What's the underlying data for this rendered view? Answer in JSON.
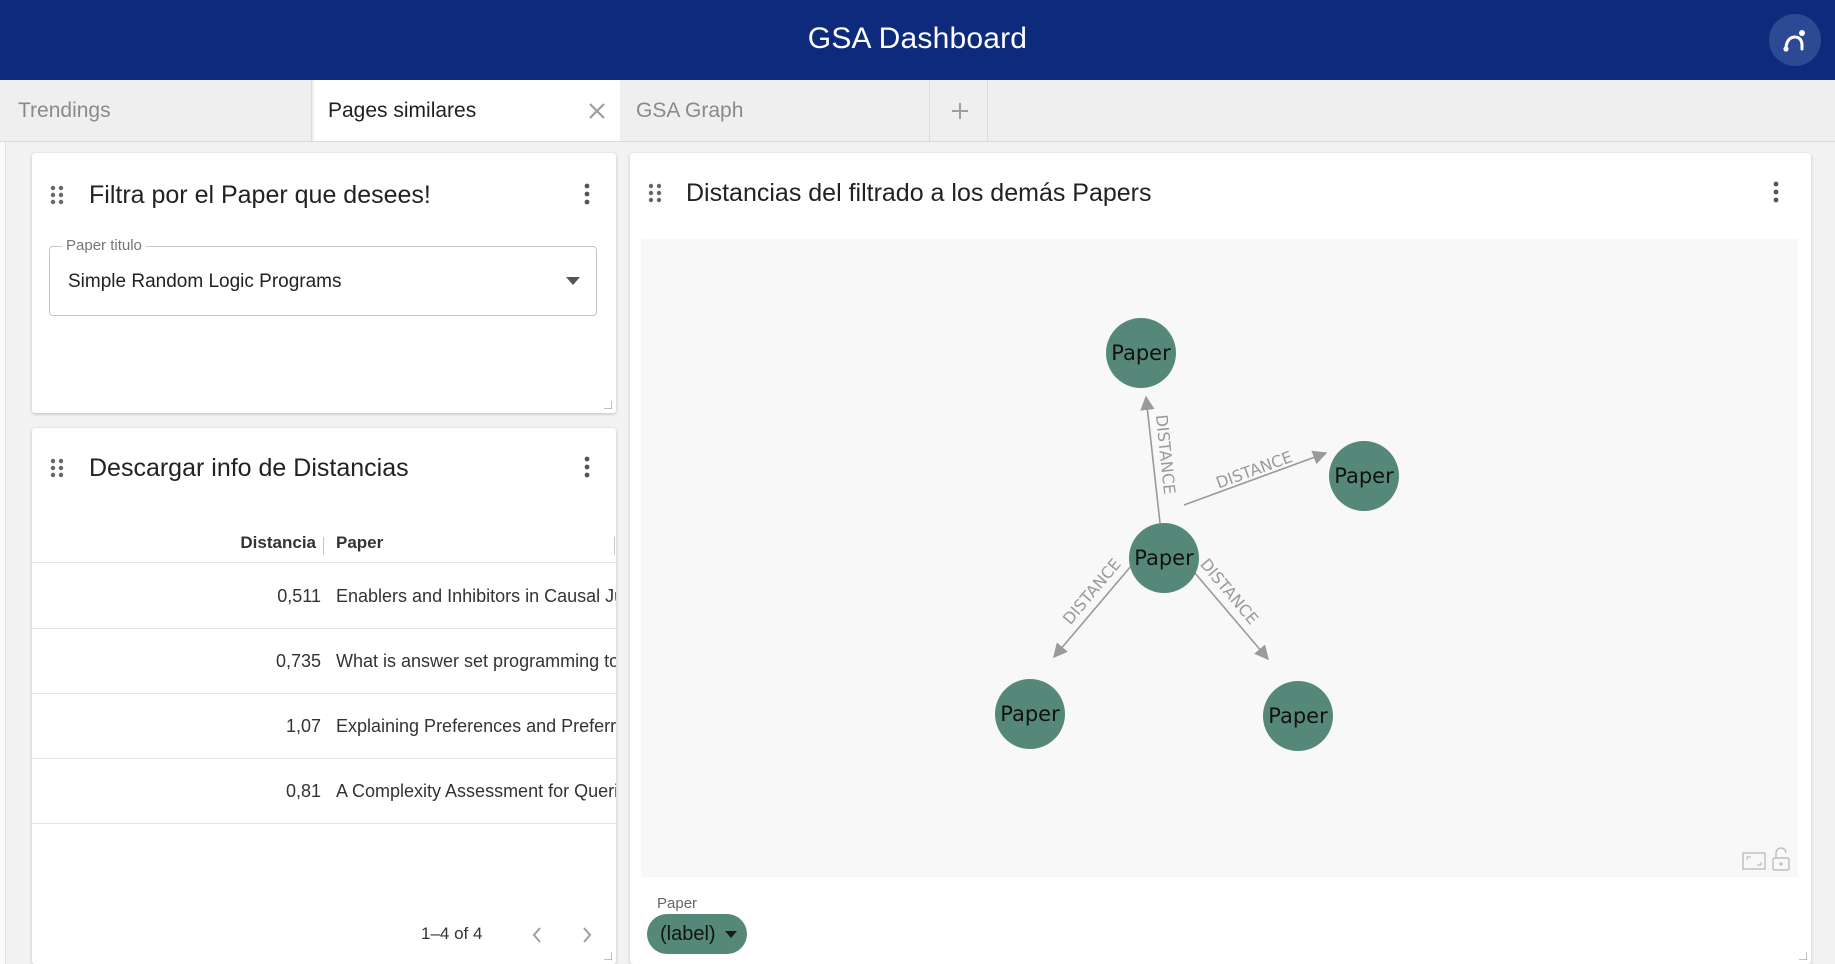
{
  "app": {
    "title": "GSA Dashboard",
    "avatar_icon": "user-avatar-icon"
  },
  "tabs": [
    {
      "label": "Trendings",
      "active": false
    },
    {
      "label": "Pages similares",
      "active": true
    },
    {
      "label": "GSA Graph",
      "active": false
    }
  ],
  "filter_card": {
    "title": "Filtra por el Paper que desees!",
    "field_label": "Paper titulo",
    "field_value": "Simple Random Logic Programs"
  },
  "table_card": {
    "title": "Descargar info de Distancias",
    "columns": [
      "Distancia",
      "Paper"
    ],
    "rows": [
      {
        "distancia": "0,511",
        "paper": "Enablers and Inhibitors in Causal Ju"
      },
      {
        "distancia": "0,735",
        "paper": "What is answer set programming to"
      },
      {
        "distancia": "1,07",
        "paper": "Explaining Preferences and Preferri"
      },
      {
        "distancia": "0,81",
        "paper": "A Complexity Assessment for Queri"
      }
    ],
    "pagination": "1–4 of 4"
  },
  "graph_card": {
    "title": "Distancias del filtrado a los demás Papers",
    "node_color": "#568879",
    "nodes": [
      {
        "id": "center",
        "label": "Paper"
      },
      {
        "id": "top",
        "label": "Paper"
      },
      {
        "id": "right",
        "label": "Paper"
      },
      {
        "id": "bottom-left",
        "label": "Paper"
      },
      {
        "id": "bottom-right",
        "label": "Paper"
      }
    ],
    "edges": [
      {
        "from": "center",
        "to": "top",
        "label": "DISTANCE"
      },
      {
        "from": "center",
        "to": "right",
        "label": "DISTANCE"
      },
      {
        "from": "center",
        "to": "bottom-left",
        "label": "DISTANCE"
      },
      {
        "from": "center",
        "to": "bottom-right",
        "label": "DISTANCE"
      }
    ],
    "legend_label": "Paper",
    "legend_pill": "(label)"
  }
}
